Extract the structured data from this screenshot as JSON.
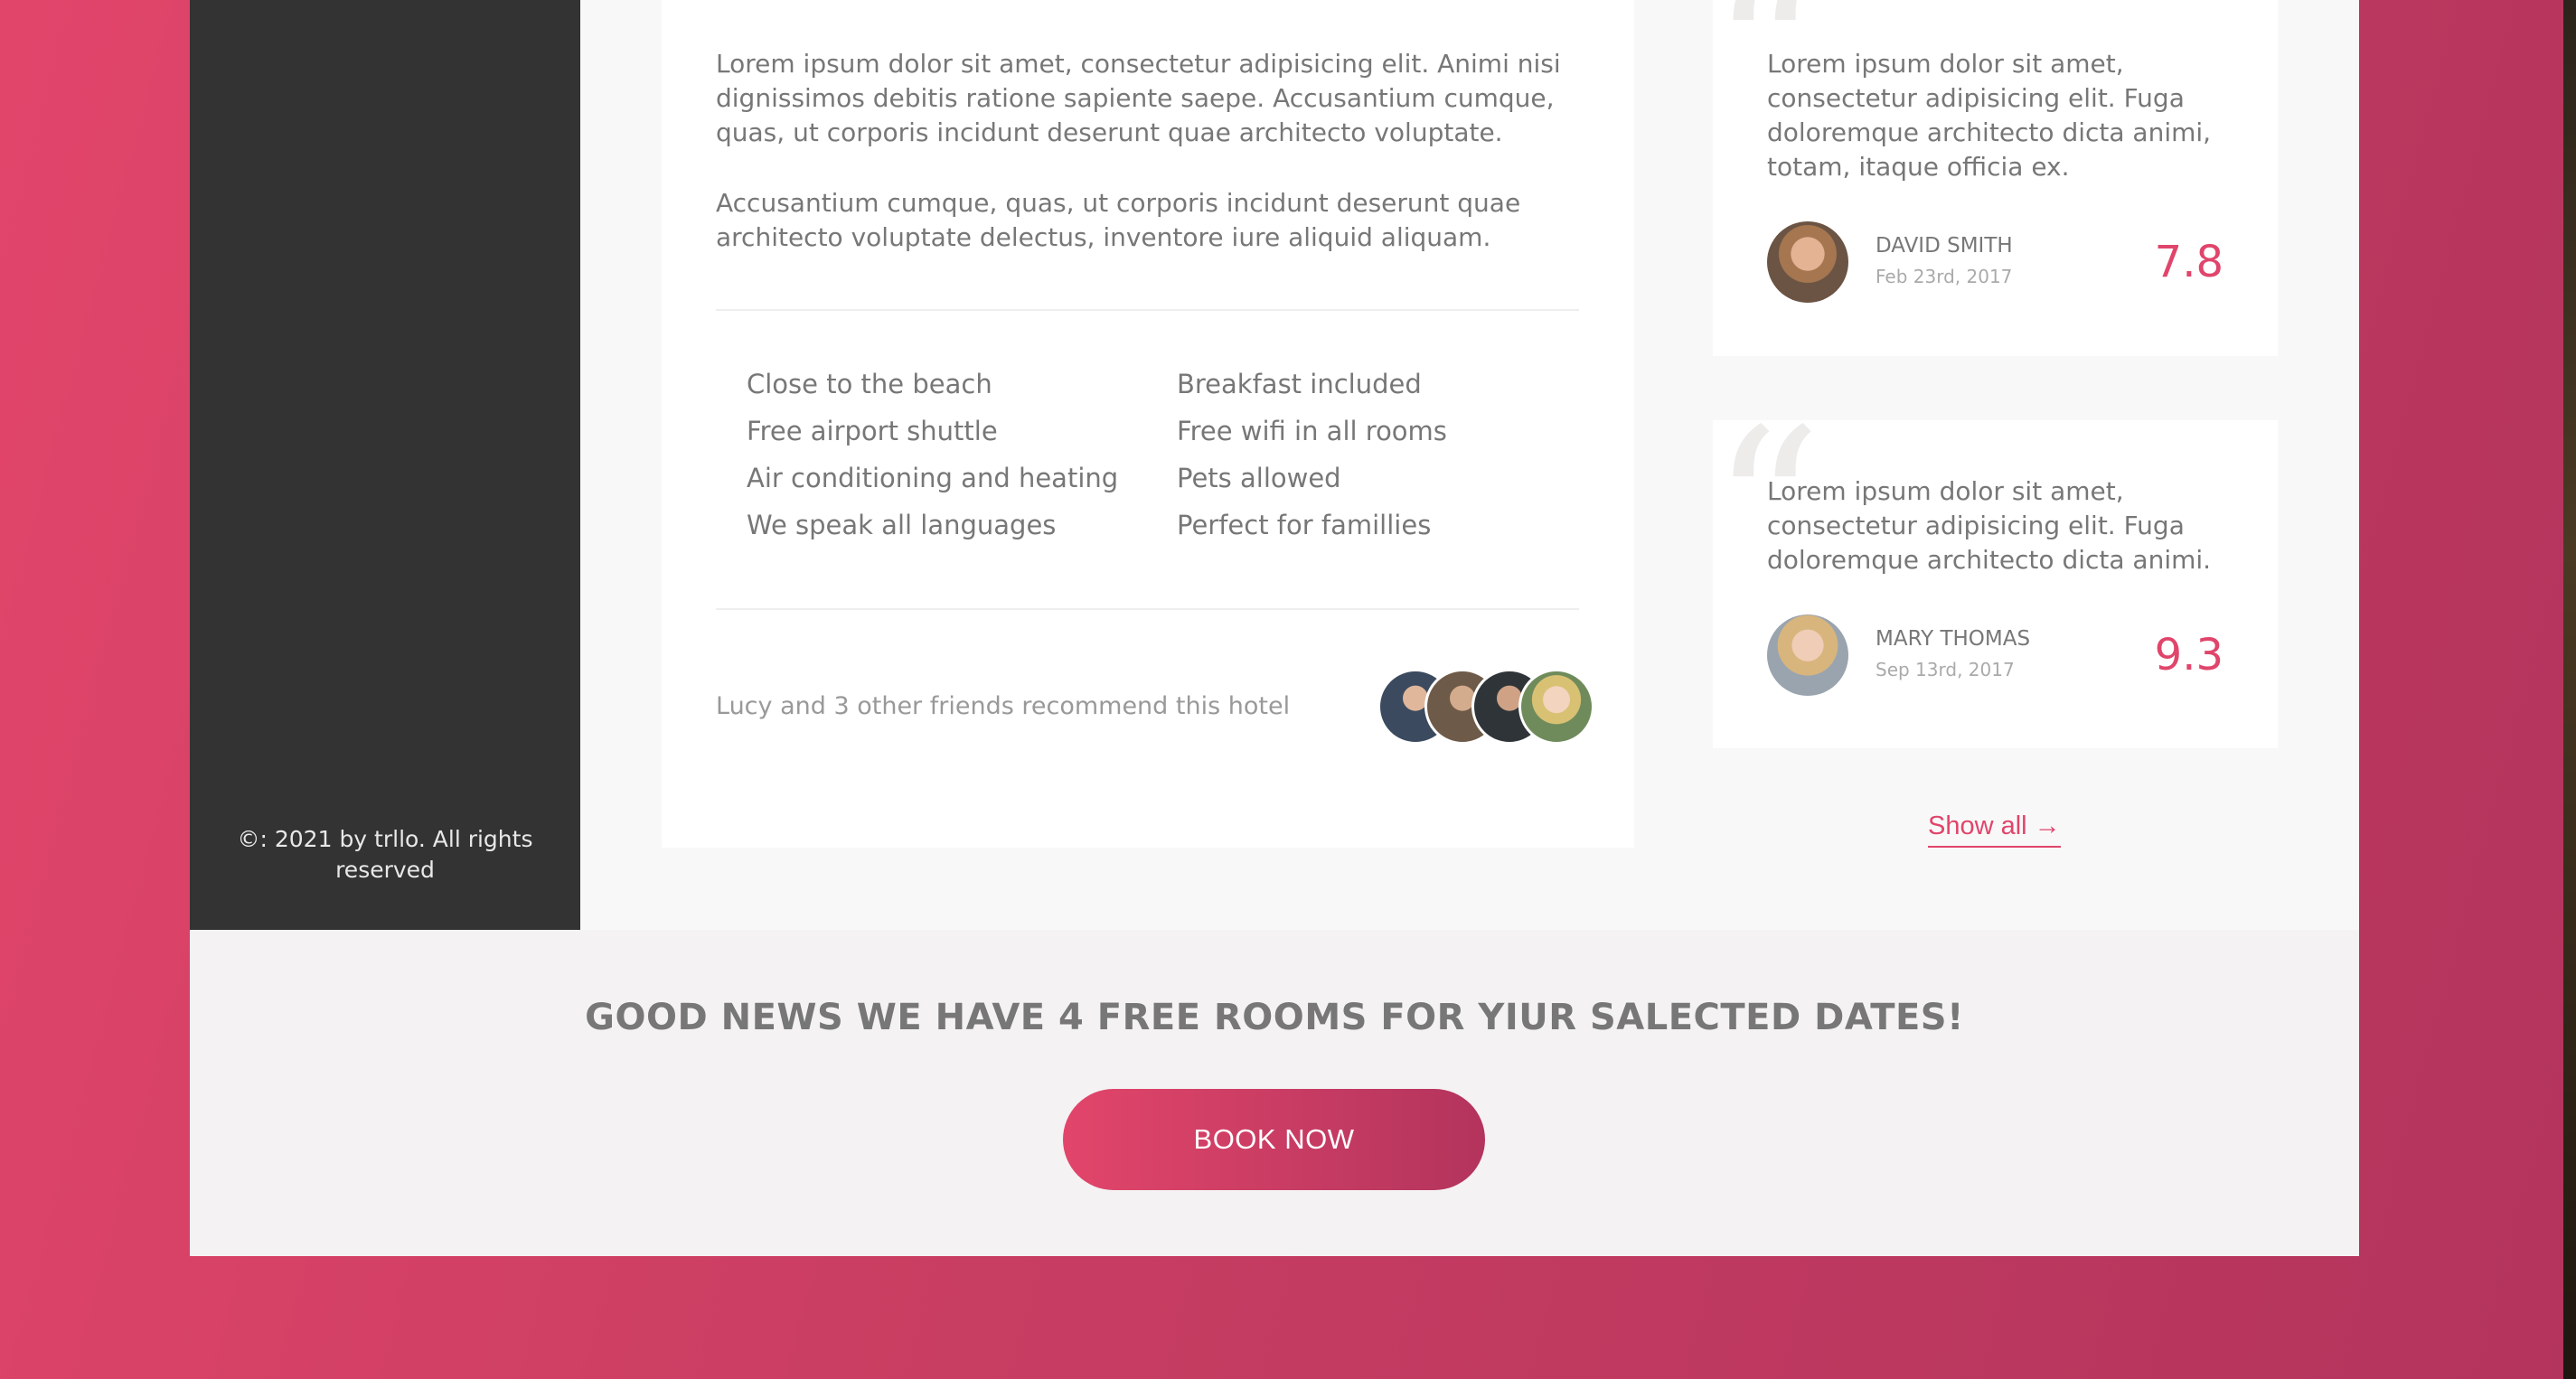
{
  "sidebar": {
    "copyright": "©: 2021 by trllo. All rights reserved"
  },
  "description": {
    "paragraphs": [
      "Lorem ipsum dolor sit amet, consectetur adipisicing elit. Animi nisi dignissimos debitis ratione sapiente saepe. Accusantium cumque, quas, ut corporis incidunt deserunt quae architecto voluptate.",
      "Accusantium cumque, quas, ut corporis incidunt deserunt quae architecto voluptate delectus, inventore iure aliquid aliquam."
    ],
    "features_left": [
      "Close to the beach",
      "Free airport shuttle",
      "Air conditioning and heating",
      "We speak all languages"
    ],
    "features_right": [
      "Breakfast included",
      "Free wifi in all rooms",
      "Pets allowed",
      "Perfect for famillies"
    ],
    "recommend_text": "Lucy and 3 other friends recommend this hotel"
  },
  "reviews": [
    {
      "text": "Lorem ipsum dolor sit amet, consectetur adipisicing elit. Fuga doloremque architecto dicta animi, totam, itaque officia ex.",
      "name": "DAVID SMITH",
      "date": "Feb 23rd, 2017",
      "score": "7.8"
    },
    {
      "text": "Lorem ipsum dolor sit amet, consectetur adipisicing elit. Fuga doloremque architecto dicta animi.",
      "name": "MARY THOMAS",
      "date": "Sep 13rd, 2017",
      "score": "9.3"
    }
  ],
  "show_all": "Show all →",
  "cta": {
    "heading": "GOOD NEWS WE HAVE 4 FREE ROOMS FOR YIUR SALECTED DATES!",
    "button": "BOOK NOW"
  },
  "icons": {
    "quote": "quote-icon"
  },
  "colors": {
    "accent": "#e0456b",
    "accent_dark": "#b3345d",
    "sidebar": "#333333"
  }
}
